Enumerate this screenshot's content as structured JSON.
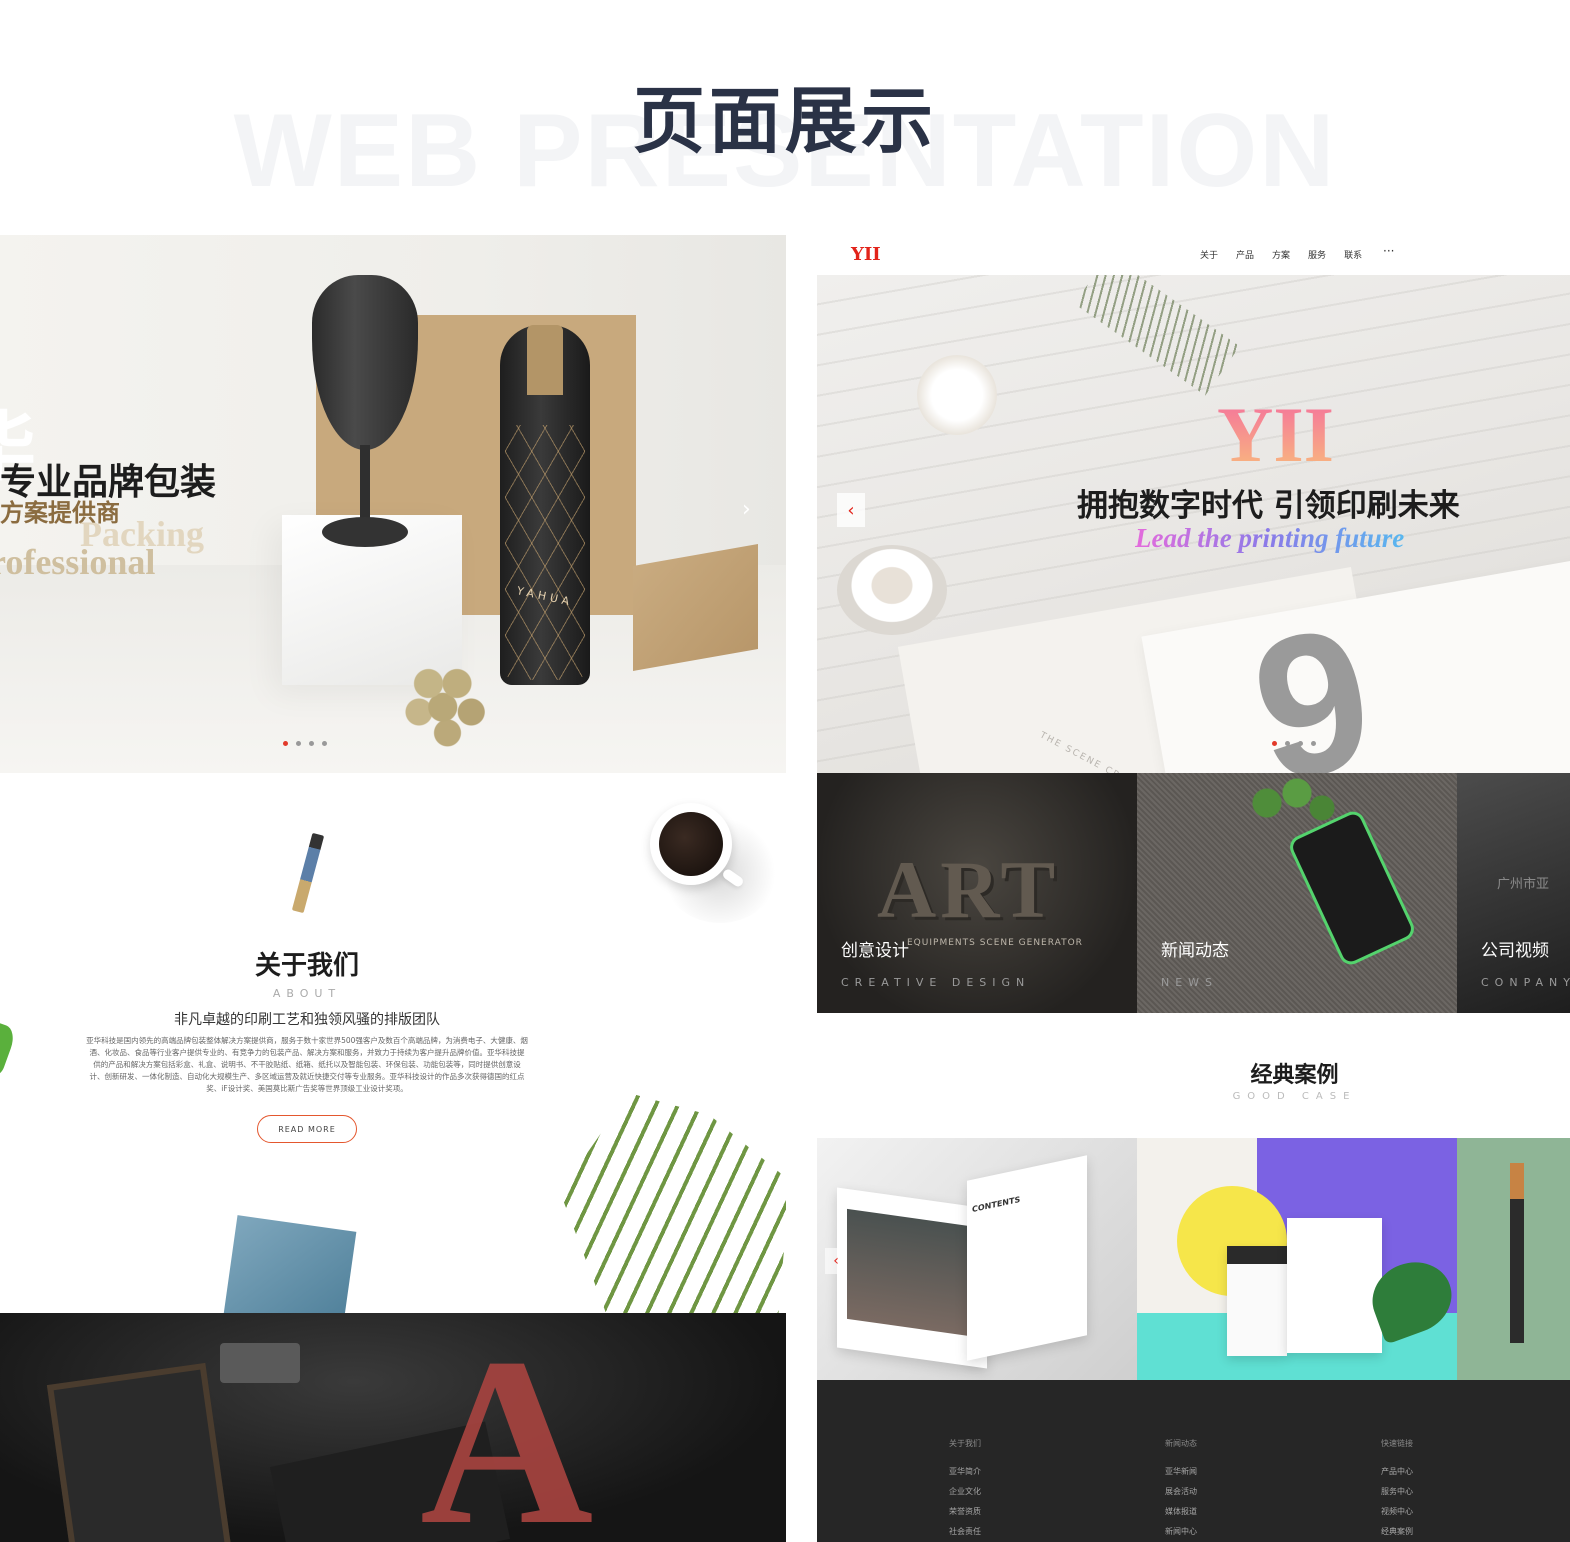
{
  "header": {
    "title": "页面展示",
    "background_text": "WEB PRESENTATION"
  },
  "left": {
    "hero": {
      "big_char": "华",
      "line1": "专业品牌包装",
      "line2": "方案提供商",
      "en1": "Packing",
      "en2": "rofessional",
      "bottle_label": "YAHUA",
      "next_arrow": "›"
    },
    "about": {
      "title": "关于我们",
      "en": "ABOUT",
      "subtitle": "非凡卓越的印刷工艺和独领风骚的排版团队",
      "body": "亚华科技是国内领先的高端品牌包装整体解决方案提供商，服务于数十家世界500强客户及数百个高端品牌，为消费电子、大健康、烟酒、化妆品、食品等行业客户提供专业的、有竞争力的包装产品、解决方案和服务，并致力于持续为客户提升品牌价值。亚华科技提供的产品和解决方案包括彩盒、礼盒、说明书、不干胶贴纸、纸箱、纸托以及智能包装、环保包装、功能包装等，同时提供创意设计、创新研发、一体化制造、自动化大规模生产、多区域运营及就近快捷交付等专业服务。亚华科技设计的作品多次获得德国的红点奖、iF设计奖、美国莫比斯广告奖等世界顶级工业设计奖项。",
      "read_more": "READ MORE"
    }
  },
  "right": {
    "nav": {
      "logo": "YII",
      "items": [
        "关于",
        "产品",
        "方案",
        "服务",
        "联系"
      ],
      "more": "···"
    },
    "hero": {
      "logo": "YII",
      "slogan": "拥抱数字时代 引领印刷未来",
      "slogan_en": "Lead the printing future",
      "prev_arrow": "‹",
      "scene_text": "THE SCENE CR"
    },
    "tiles": [
      {
        "label": "创意设计",
        "en": "CREATIVE DESIGN"
      },
      {
        "label": "新闻动态",
        "en": "NEWS"
      },
      {
        "label": "公司视频",
        "en": "CONPANY"
      }
    ],
    "tile_art": {
      "art": "ART",
      "sub": "EQUIPMENTS SCENE GENERATOR"
    },
    "tile3_text": "广州市亚",
    "cases": {
      "title": "经典案例",
      "en": "GOOD CASE",
      "magazine_heading": "CONTENTS",
      "prev_arrow": "‹"
    },
    "footer": {
      "columns": [
        {
          "head": "关于我们",
          "links": [
            "亚华简介",
            "企业文化",
            "荣誉资质",
            "社会责任"
          ]
        },
        {
          "head": "新闻动态",
          "links": [
            "亚华新闻",
            "展会活动",
            "媒体报道",
            "新闻中心"
          ]
        },
        {
          "head": "快速链接",
          "links": [
            "产品中心",
            "服务中心",
            "视频中心",
            "经典案例"
          ]
        }
      ]
    }
  },
  "colors": {
    "title": "#2a3246",
    "accent_red": "#e2231a",
    "read_more_border": "#e4572e",
    "footer_bg": "#262626"
  }
}
